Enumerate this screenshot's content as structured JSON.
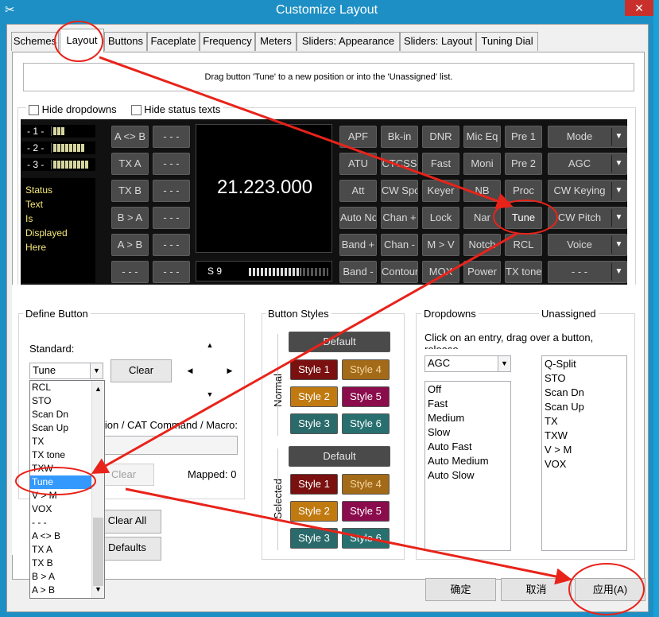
{
  "window": {
    "title": "Customize Layout",
    "close_label": "✕"
  },
  "tabs": [
    "Schemes",
    "Layout",
    "Buttons",
    "Faceplate",
    "Frequency",
    "Meters",
    "Sliders: Appearance",
    "Sliders: Layout",
    "Tuning Dial"
  ],
  "info_text": "Drag button 'Tune' to a new position or into the 'Unassigned' list.",
  "options": {
    "hide_dropdowns": "Hide dropdowns",
    "hide_status_texts": "Hide status texts"
  },
  "receivers": [
    {
      "label": "- 1 -",
      "bars": 3
    },
    {
      "label": "- 2 -",
      "bars": 8
    },
    {
      "label": "- 3 -",
      "bars": 9
    }
  ],
  "status_lines": [
    "Status",
    "Text",
    "Is",
    "Displayed",
    "Here"
  ],
  "left_buttons": [
    [
      "A <> B",
      "- - -"
    ],
    [
      "TX A",
      "- - -"
    ],
    [
      "TX B",
      "- - -"
    ],
    [
      "B > A",
      "- - -"
    ],
    [
      "A > B",
      "- - -"
    ],
    [
      "- - -",
      "- - -"
    ]
  ],
  "frequency": "21.223.000",
  "smeter_label": "S 9",
  "grid_buttons": [
    [
      "APF",
      "Bk-in",
      "DNR",
      "Mic Eq",
      "Pre 1"
    ],
    [
      "ATU",
      "CTCSS",
      "Fast",
      "Moni",
      "Pre 2"
    ],
    [
      "Att",
      "CW Spot",
      "Keyer",
      "NB",
      "Proc"
    ],
    [
      "Auto Notch",
      "Chan +",
      "Lock",
      "Nar",
      "Tune"
    ],
    [
      "Band +",
      "Chan -",
      "M > V",
      "Notch",
      "RCL"
    ],
    [
      "Band -",
      "Contour",
      "MOX",
      "Power",
      "TX tone"
    ]
  ],
  "combo_buttons": [
    "Mode",
    "AGC",
    "CW Keying",
    "CW Pitch",
    "Voice",
    "- - -"
  ],
  "define_button": {
    "title": "Define Button",
    "standard_label": "Standard:",
    "standard_value": "Tune",
    "clear_label": "Clear",
    "cat_label": "Function / CAT Command / Macro:",
    "clear2_label": "Clear",
    "mapped_label": "Mapped: 0",
    "clear_all_label": "Clear All",
    "defaults_label": "Defaults"
  },
  "dropdown_items": [
    "RCL",
    "STO",
    "Scan Dn",
    "Scan Up",
    "TX",
    "TX tone",
    "TXW",
    "Tune",
    "V > M",
    "VOX",
    "- - -",
    "A <> B",
    "TX A",
    "TX B",
    "B > A",
    "A > B"
  ],
  "dropdown_selected": "Tune",
  "button_styles": {
    "title": "Button Styles",
    "normal_label": "Normal",
    "selected_label": "Selected",
    "default_label": "Default",
    "styles": [
      "Style 1",
      "Style 4",
      "Style 2",
      "Style 5",
      "Style 3",
      "Style 6"
    ]
  },
  "dropdowns": {
    "title": "Dropdowns",
    "hint": "Click on an entry, drag over a button, release",
    "selected": "AGC",
    "items": [
      "Off",
      "Fast",
      "Medium",
      "Slow",
      "Auto Fast",
      "Auto Medium",
      "Auto Slow"
    ]
  },
  "unassigned": {
    "title": "Unassigned",
    "items": [
      "Q-Split",
      "STO",
      "Scan Dn",
      "Scan Up",
      "TX",
      "TXW",
      "V > M",
      "VOX"
    ]
  },
  "footer": {
    "ok": "确定",
    "cancel": "取消",
    "apply": "应用(A)"
  },
  "annotation_color": "#e8231a"
}
